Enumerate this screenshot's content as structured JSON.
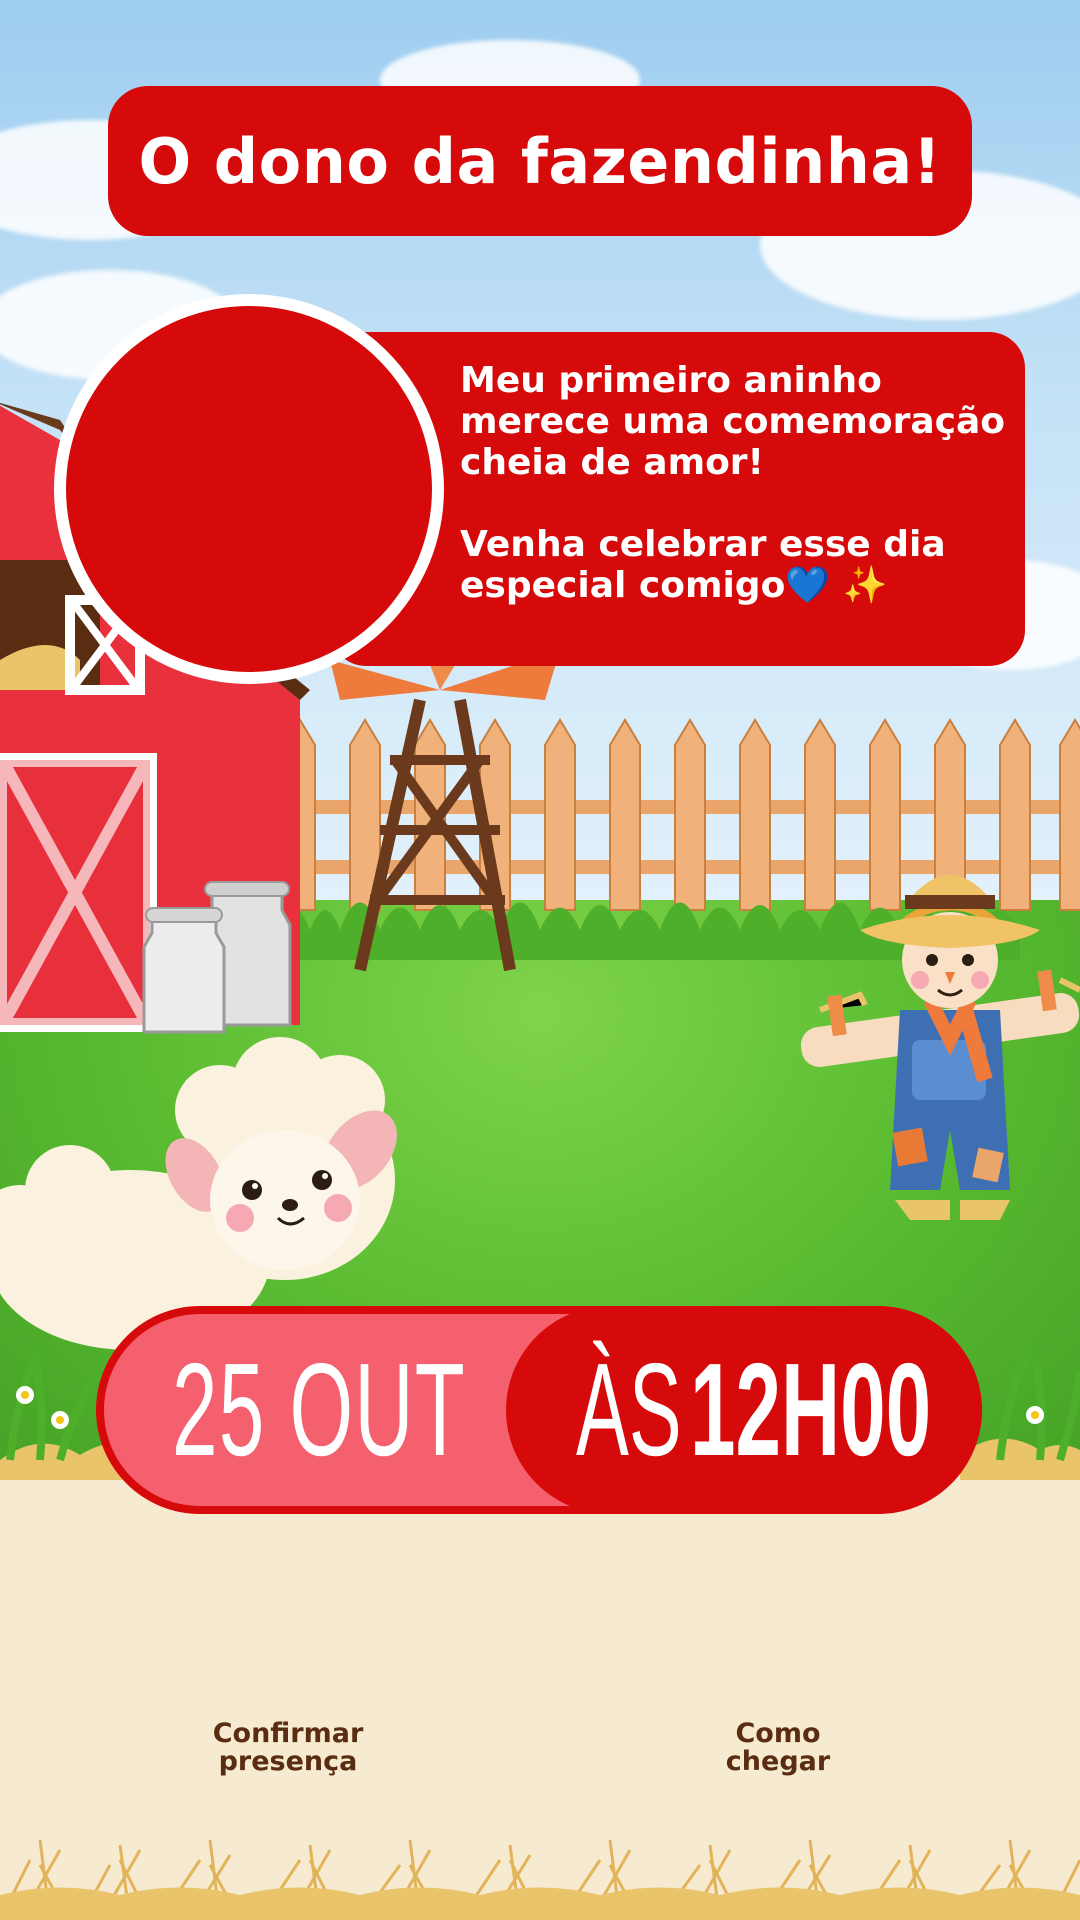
{
  "invitation": {
    "title": "O dono da fazendinha!",
    "message_line_1": "Meu primeiro aninho merece uma comemoração cheia de amor!",
    "message_line_2_text": "Venha celebrar esse dia especial comigo",
    "message_line_2_emoji_heart": "💙",
    "message_line_2_emoji_sparkles": "✨",
    "date": "25 OUT",
    "time_prefix": "ÀS",
    "time": "12H00"
  },
  "actions": {
    "rsvp_line_1": "Confirmar",
    "rsvp_line_2": "presença",
    "directions_line_1": "Como",
    "directions_line_2": "chegar"
  },
  "colors": {
    "primary_red": "#d60a0a",
    "pink": "#f5606e",
    "cream": "#f6ead0",
    "brown_text": "#5a2d12"
  },
  "icons": [
    "barn-icon",
    "windmill-icon",
    "milk-can-icon",
    "sheep-icon",
    "scarecrow-icon",
    "fence-icon",
    "hay-icon"
  ]
}
